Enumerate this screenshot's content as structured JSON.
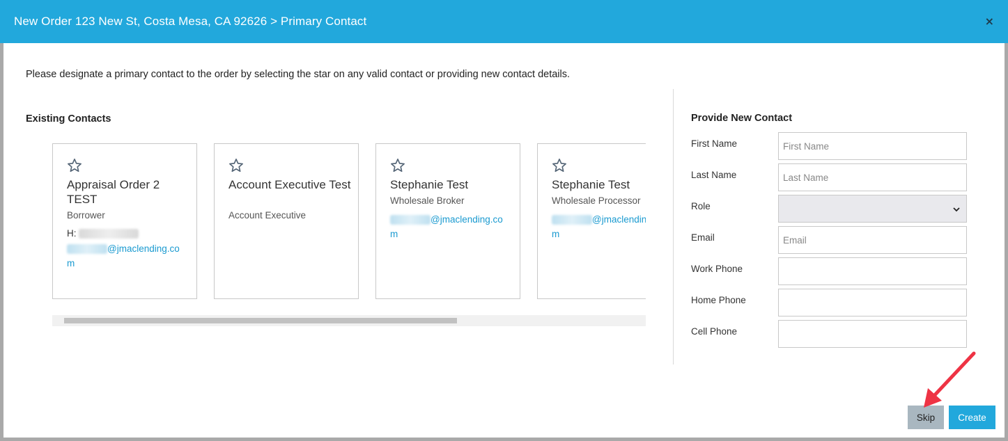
{
  "header": {
    "title": "New Order 123 New St, Costa Mesa, CA 92626 > Primary Contact",
    "close_glyph": "×"
  },
  "instruction": "Please designate a primary contact to the order by selecting the star on any valid contact or providing new contact details.",
  "existing_contacts": {
    "title": "Existing Contacts",
    "contacts": [
      {
        "name": "Appraisal Order 2 TEST",
        "role": "Borrower",
        "phone_prefix": "H:",
        "email_visible": "@jmaclending.com"
      },
      {
        "name": "Account Executive Test",
        "role": "Account Executive"
      },
      {
        "name": "Stephanie Test",
        "role": "Wholesale Broker",
        "email_visible": "@jmaclending.com"
      },
      {
        "name": "Stephanie Test",
        "role": "Wholesale Processor",
        "email_visible": "@jmaclending.com"
      }
    ]
  },
  "new_contact": {
    "title": "Provide New Contact",
    "fields": {
      "first_name": {
        "label": "First Name",
        "placeholder": "First Name"
      },
      "last_name": {
        "label": "Last Name",
        "placeholder": "Last Name"
      },
      "role": {
        "label": "Role",
        "value": ""
      },
      "email": {
        "label": "Email",
        "placeholder": "Email"
      },
      "work_phone": {
        "label": "Work Phone",
        "placeholder": ""
      },
      "home_phone": {
        "label": "Home Phone",
        "placeholder": ""
      },
      "cell_phone": {
        "label": "Cell Phone",
        "placeholder": ""
      }
    }
  },
  "buttons": {
    "skip": "Skip",
    "create": "Create"
  },
  "colors": {
    "header_bg": "#22a8dc",
    "link": "#1a9ad0",
    "skip_bg": "#a9b7c0",
    "create_bg": "#22a8dc",
    "annotation_arrow": "#ee3344"
  }
}
